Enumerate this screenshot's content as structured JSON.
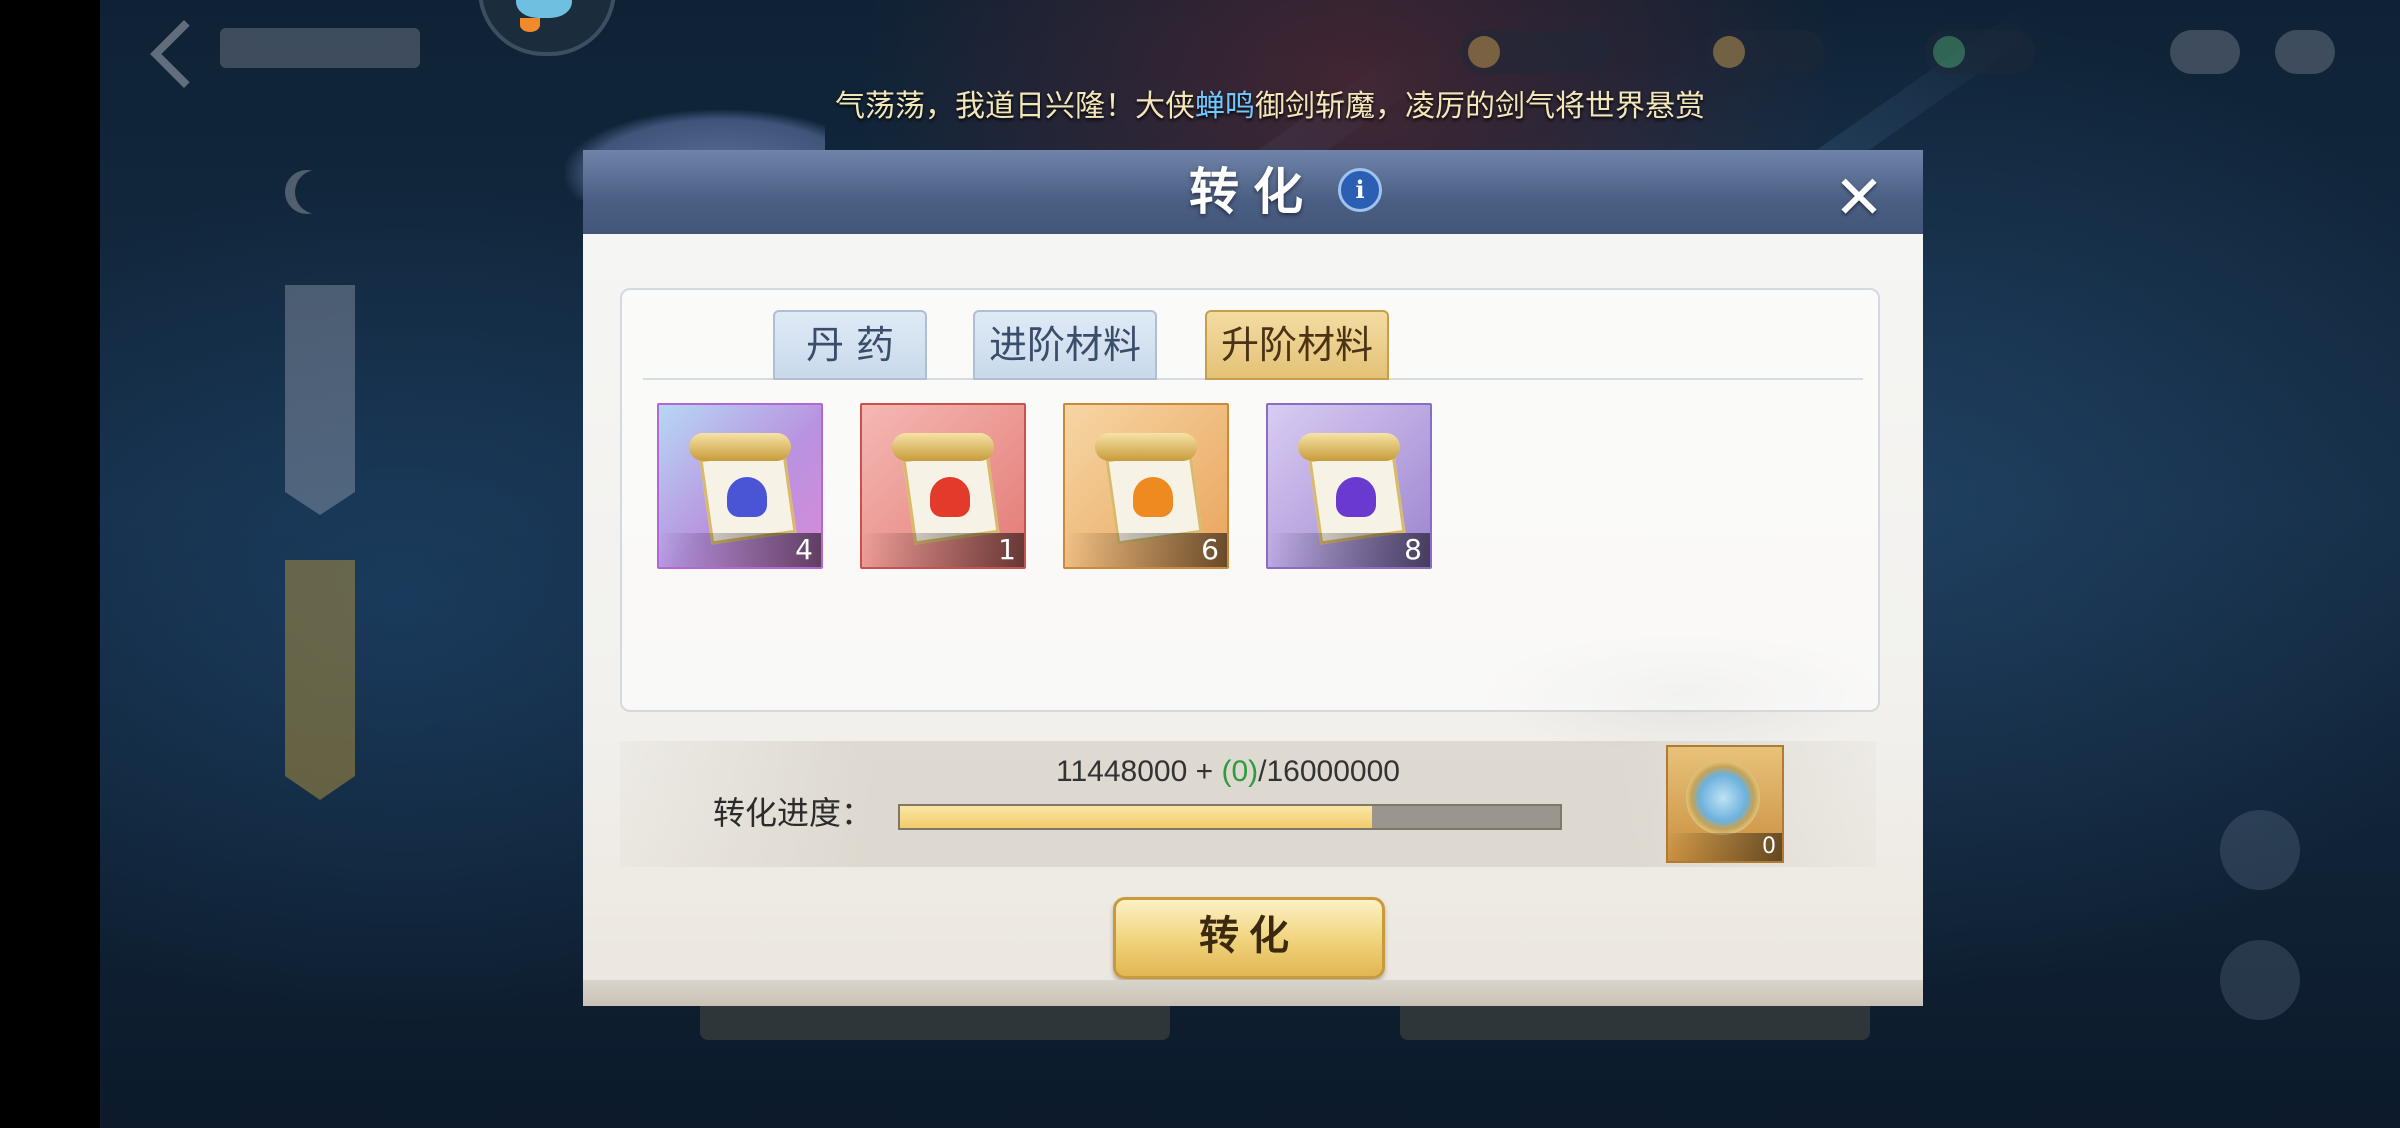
{
  "ticker": {
    "prefix": "气荡荡，我道日兴隆！大侠",
    "highlight": "蝉鸣",
    "suffix": "御剑斩魔，凌厉的剑气将世界悬赏"
  },
  "dialog": {
    "title": "转化",
    "info_icon": "i",
    "close_icon": "✕",
    "tabs": [
      {
        "label": "丹 药",
        "state": "inactive"
      },
      {
        "label": "进阶材料",
        "state": "inactive"
      },
      {
        "label": "升阶材料",
        "state": "active"
      }
    ],
    "items": [
      {
        "name": "purple-blue scroll",
        "count": "4",
        "color": "#a97cd6"
      },
      {
        "name": "red scroll",
        "count": "1",
        "color": "#e47a75"
      },
      {
        "name": "orange scroll",
        "count": "6",
        "color": "#e9a45b"
      },
      {
        "name": "violet scroll",
        "count": "8",
        "color": "#9b84d0"
      }
    ],
    "progress": {
      "label": "转化进度：",
      "current": "11448000",
      "plus": " + ",
      "added": "(0)",
      "total": "/16000000",
      "fraction": 0.7155
    },
    "reward": {
      "icon": "coin-icon",
      "count": "0"
    },
    "convert_button": "转化"
  },
  "colors": {
    "header": "#4b5f84",
    "gold": "#f1cc6c",
    "green": "#2f9a3e",
    "highlight": "#6fc8ff"
  }
}
